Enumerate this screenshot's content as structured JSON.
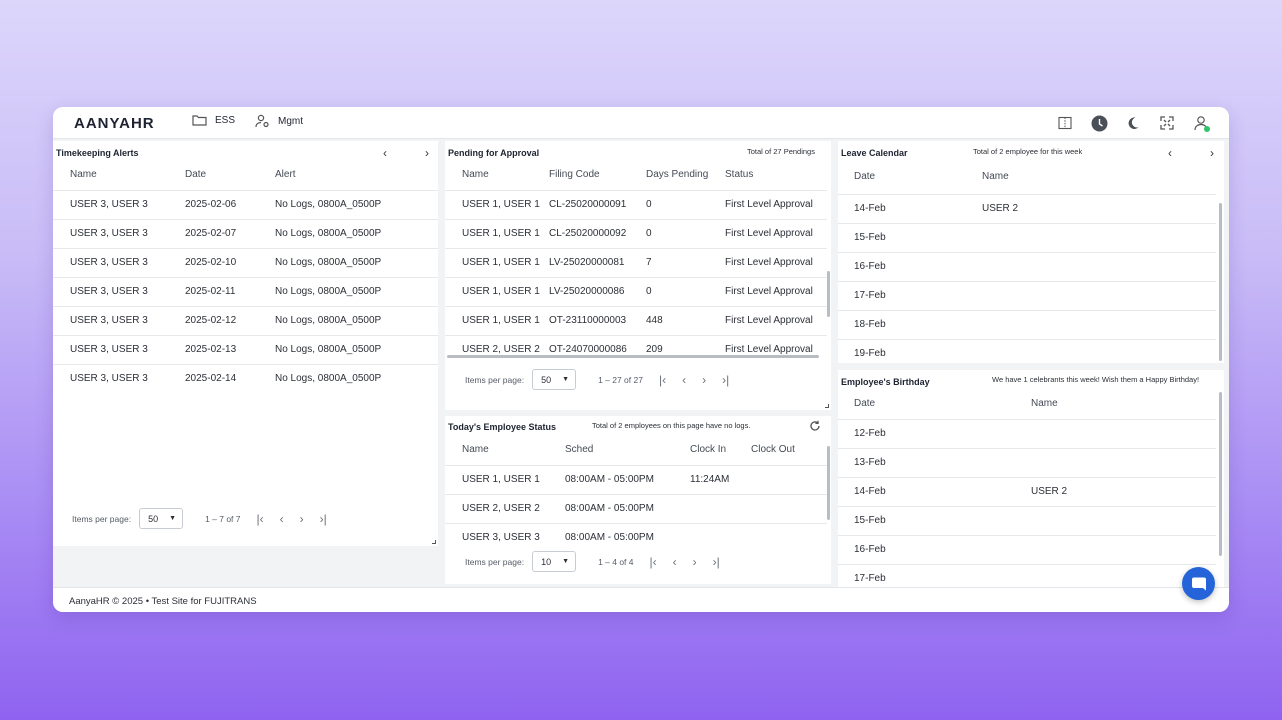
{
  "app": {
    "logo": "AANYAHR",
    "nav": [
      {
        "label": "ESS",
        "icon": "folder-icon"
      },
      {
        "label": "Mgmt",
        "icon": "user-gear-icon"
      }
    ],
    "top_icons": [
      "split-view-icon",
      "clock-icon",
      "moon-icon",
      "fullscreen-icon",
      "user-icon"
    ]
  },
  "timekeeping": {
    "title": "Timekeeping Alerts",
    "columns": [
      "Name",
      "Date",
      "Alert"
    ],
    "rows": [
      [
        "USER 3, USER 3",
        "2025-02-06",
        "No Logs, 0800A_0500P"
      ],
      [
        "USER 3, USER 3",
        "2025-02-07",
        "No Logs, 0800A_0500P"
      ],
      [
        "USER 3, USER 3",
        "2025-02-10",
        "No Logs, 0800A_0500P"
      ],
      [
        "USER 3, USER 3",
        "2025-02-11",
        "No Logs, 0800A_0500P"
      ],
      [
        "USER 3, USER 3",
        "2025-02-12",
        "No Logs, 0800A_0500P"
      ],
      [
        "USER 3, USER 3",
        "2025-02-13",
        "No Logs, 0800A_0500P"
      ],
      [
        "USER 3, USER 3",
        "2025-02-14",
        "No Logs, 0800A_0500P"
      ]
    ],
    "pager": {
      "label": "Items per page:",
      "size": "50",
      "range": "1 – 7 of 7"
    }
  },
  "pending": {
    "title": "Pending for Approval",
    "subtitle": "Total of 27 Pendings",
    "columns": [
      "Name",
      "Filing Code",
      "Days Pending",
      "Status"
    ],
    "rows": [
      [
        "USER 1, USER 1",
        "CL-25020000091",
        "0",
        "First Level Approval"
      ],
      [
        "USER 1, USER 1",
        "CL-25020000092",
        "0",
        "First Level Approval"
      ],
      [
        "USER 1, USER 1",
        "LV-25020000081",
        "7",
        "First Level Approval"
      ],
      [
        "USER 1, USER 1",
        "LV-25020000086",
        "0",
        "First Level Approval"
      ],
      [
        "USER 1, USER 1",
        "OT-23110000003",
        "448",
        "First Level Approval"
      ],
      [
        "USER 2, USER 2",
        "OT-24070000086",
        "209",
        "First Level Approval"
      ]
    ],
    "pager": {
      "label": "Items per page:",
      "size": "50",
      "range": "1 – 27 of 27"
    }
  },
  "status": {
    "title": "Today's Employee Status",
    "subtitle": "Total of 2 employees on this page have no logs.",
    "columns": [
      "Name",
      "Sched",
      "Clock In",
      "Clock Out"
    ],
    "rows": [
      [
        "USER 1, USER 1",
        "08:00AM - 05:00PM",
        "11:24AM",
        ""
      ],
      [
        "USER 2, USER 2",
        "08:00AM - 05:00PM",
        "",
        ""
      ],
      [
        "USER 3, USER 3",
        "08:00AM - 05:00PM",
        "",
        ""
      ]
    ],
    "pager": {
      "label": "Items per page:",
      "size": "10",
      "range": "1 – 4 of 4"
    }
  },
  "leave": {
    "title": "Leave Calendar",
    "subtitle": "Total of 2 employee for this week",
    "columns": [
      "Date",
      "Name"
    ],
    "rows": [
      [
        "14-Feb",
        "USER 2"
      ],
      [
        "15-Feb",
        ""
      ],
      [
        "16-Feb",
        ""
      ],
      [
        "17-Feb",
        ""
      ],
      [
        "18-Feb",
        ""
      ],
      [
        "19-Feb",
        ""
      ]
    ]
  },
  "birthday": {
    "title": "Employee's Birthday",
    "subtitle": "We have 1 celebrants this week! Wish them a Happy Birthday!",
    "columns": [
      "Date",
      "Name"
    ],
    "rows": [
      [
        "12-Feb",
        ""
      ],
      [
        "13-Feb",
        ""
      ],
      [
        "14-Feb",
        "USER 2"
      ],
      [
        "15-Feb",
        ""
      ],
      [
        "16-Feb",
        ""
      ],
      [
        "17-Feb",
        ""
      ]
    ]
  },
  "footer": {
    "text": "AanyaHR © 2025 • Test Site for FUJITRANS"
  },
  "colors": {
    "accent": "#2563d9",
    "online": "#2fc36a"
  }
}
